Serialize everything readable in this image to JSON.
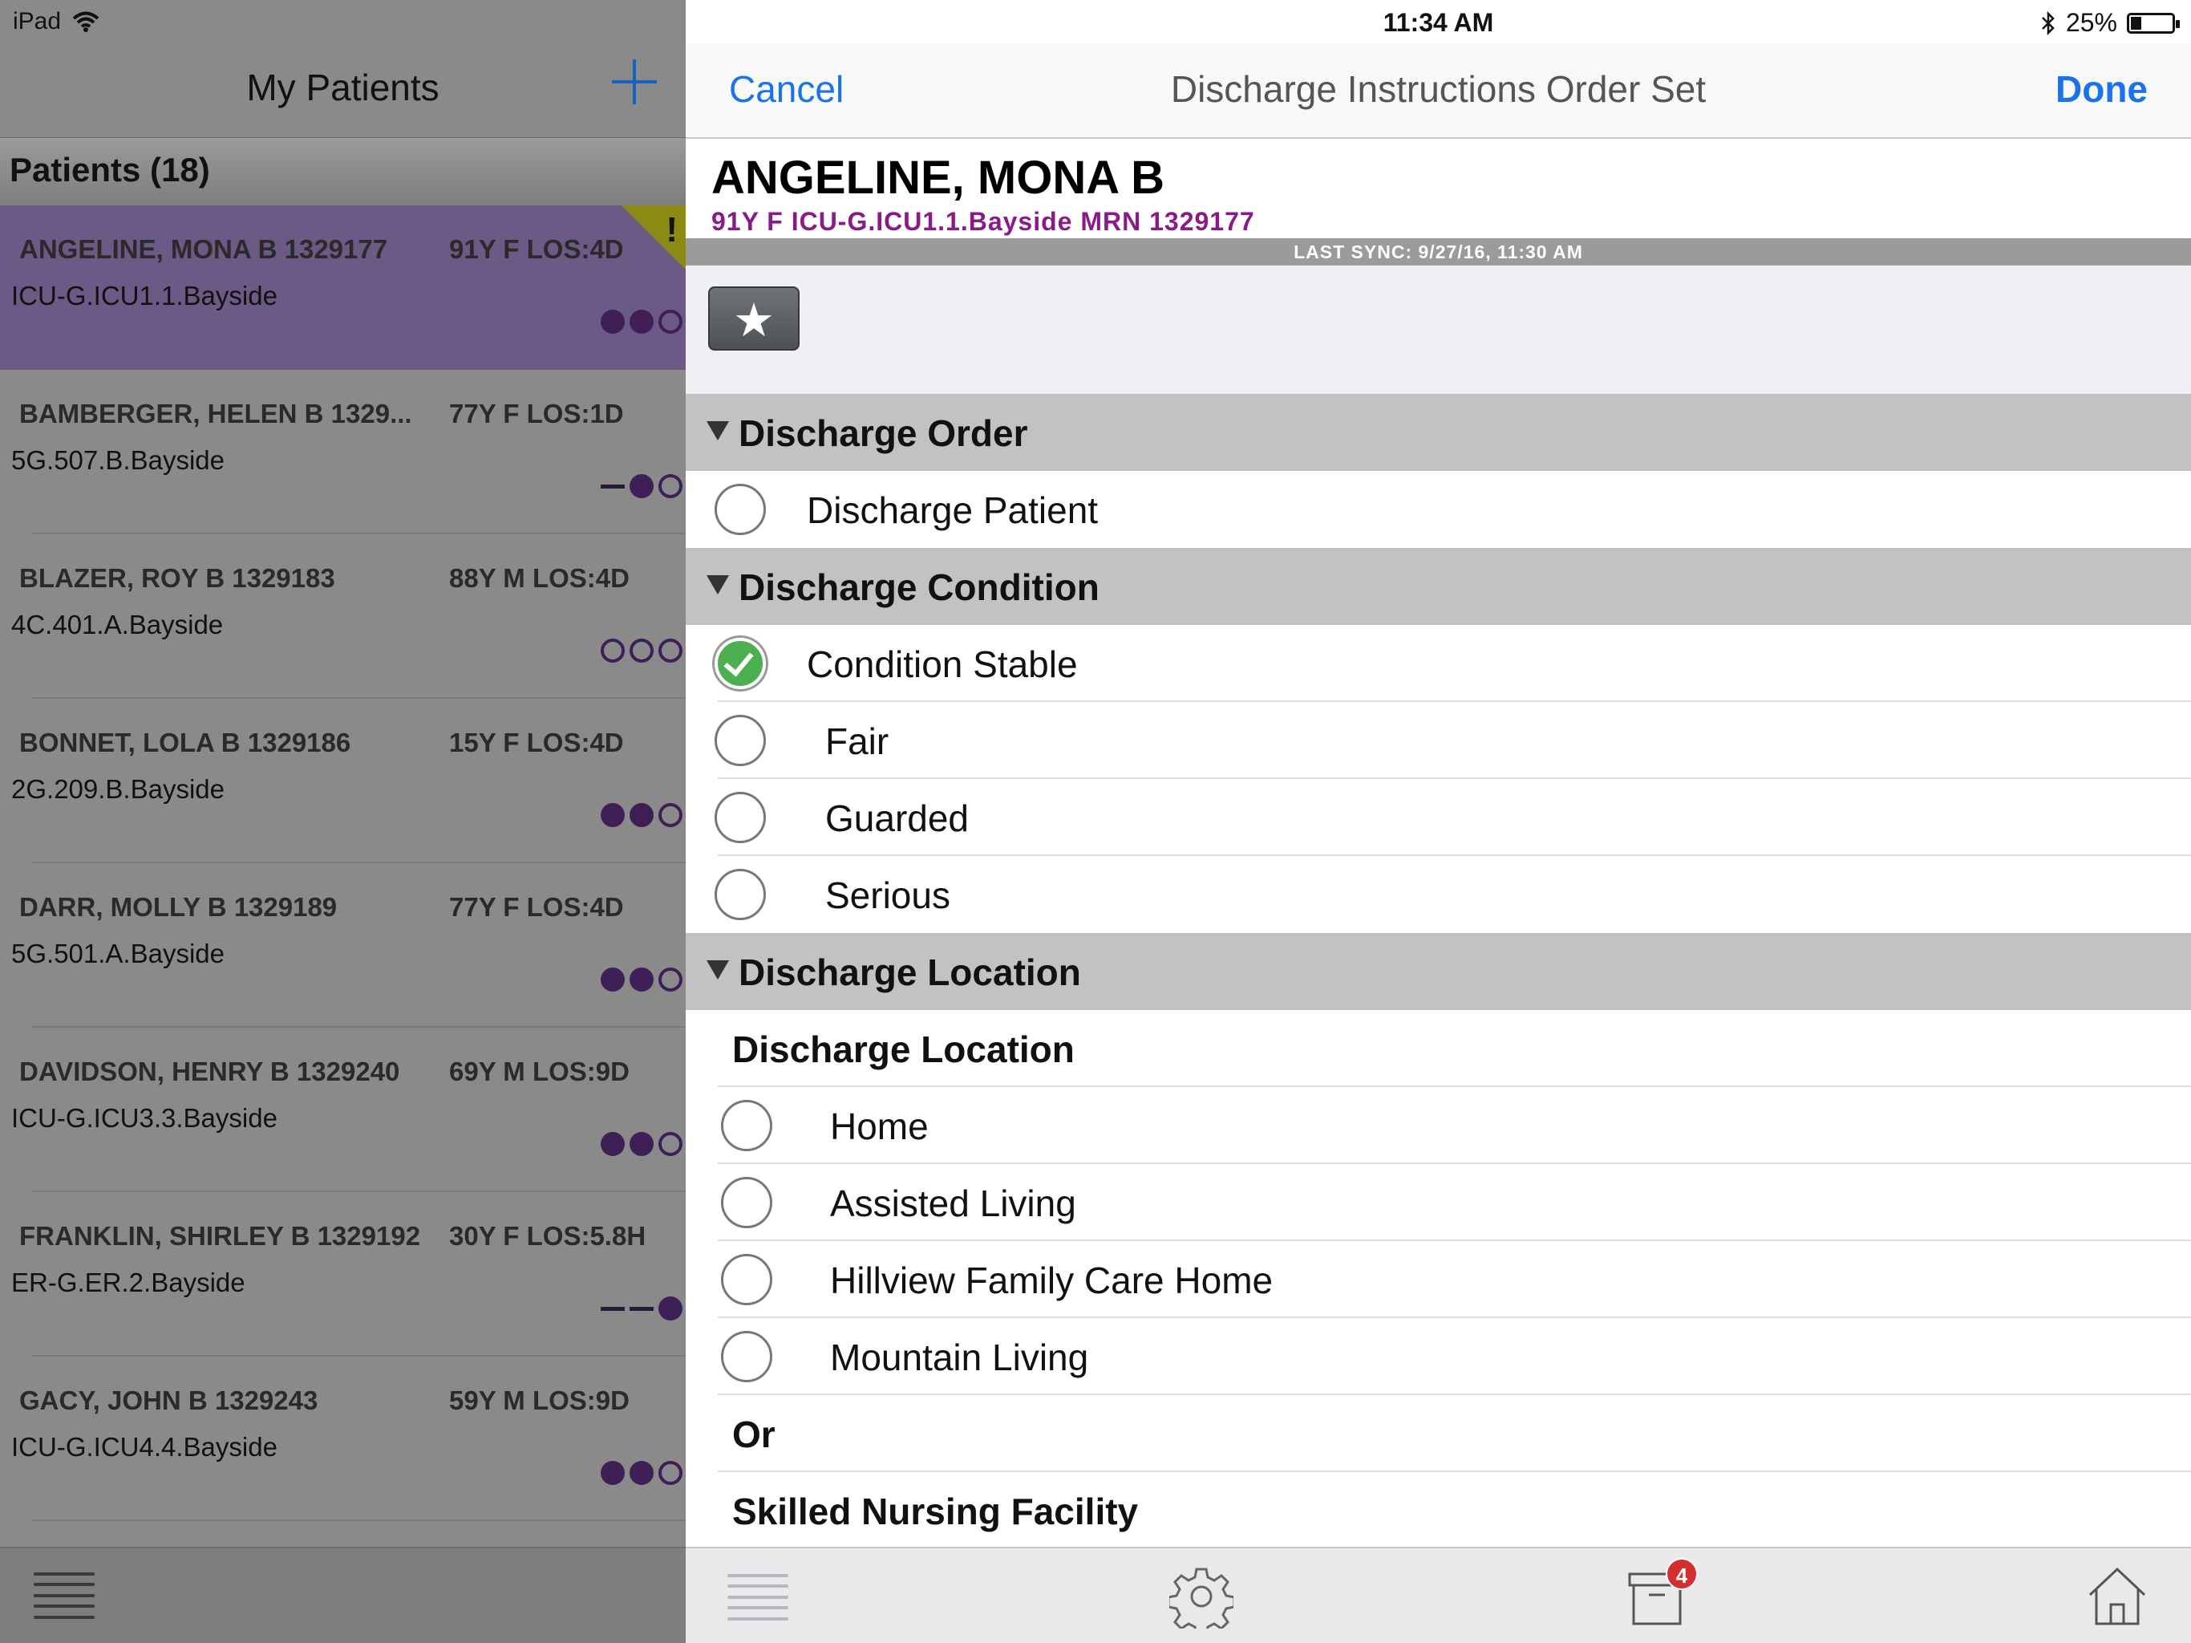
{
  "status_bar": {
    "device": "iPad",
    "time": "11:34 AM",
    "battery": "25%",
    "battery_level": 0.25
  },
  "left": {
    "title": "My Patients",
    "patients_header": "Patients (18)",
    "patients": [
      {
        "name": "ANGELINE, MONA B 1329177",
        "age": "91Y F LOS:4D",
        "location": "ICU-G.ICU1.1.Bayside",
        "indicators": [
          "filled",
          "filled",
          "empty"
        ],
        "alert": "!",
        "selected": true
      },
      {
        "name": "BAMBERGER, HELEN B 1329...",
        "age": "77Y F LOS:1D",
        "location": "5G.507.B.Bayside",
        "indicators": [
          "dash",
          "filled",
          "empty"
        ]
      },
      {
        "name": "BLAZER, ROY B 1329183",
        "age": "88Y M LOS:4D",
        "location": "4C.401.A.Bayside",
        "indicators": [
          "empty",
          "empty",
          "empty"
        ]
      },
      {
        "name": "BONNET, LOLA B 1329186",
        "age": "15Y F LOS:4D",
        "location": "2G.209.B.Bayside",
        "indicators": [
          "filled",
          "filled",
          "empty"
        ]
      },
      {
        "name": "DARR, MOLLY B 1329189",
        "age": "77Y F LOS:4D",
        "location": "5G.501.A.Bayside",
        "indicators": [
          "filled",
          "filled",
          "empty"
        ]
      },
      {
        "name": "DAVIDSON, HENRY B 1329240",
        "age": "69Y M LOS:9D",
        "location": "ICU-G.ICU3.3.Bayside",
        "indicators": [
          "filled",
          "filled",
          "empty"
        ]
      },
      {
        "name": "FRANKLIN, SHIRLEY B 1329192",
        "age": "30Y F LOS:5.8H",
        "location": "ER-G.ER.2.Bayside",
        "indicators": [
          "dash",
          "dash",
          "filled"
        ]
      },
      {
        "name": "GACY, JOHN B 1329243",
        "age": "59Y M LOS:9D",
        "location": "ICU-G.ICU4.4.Bayside",
        "indicators": [
          "filled",
          "filled",
          "empty"
        ]
      }
    ]
  },
  "right": {
    "cancel": "Cancel",
    "title": "Discharge Instructions Order Set",
    "done": "Done",
    "patient_name": "ANGELINE, MONA B",
    "patient_info": "91Y F ICU-G.ICU1.1.Bayside MRN 1329177",
    "last_sync": "LAST SYNC: 9/27/16, 11:30 AM",
    "sections": [
      {
        "type": "group",
        "label": "Discharge Order"
      },
      {
        "type": "option",
        "label": "Discharge Patient",
        "checked": false,
        "indent": 0
      },
      {
        "type": "group",
        "label": "Discharge Condition"
      },
      {
        "type": "option",
        "label": "Condition Stable",
        "checked": true,
        "indent": 0
      },
      {
        "type": "option",
        "label": "Fair",
        "checked": false,
        "indent": 1
      },
      {
        "type": "option",
        "label": "Guarded",
        "checked": false,
        "indent": 1
      },
      {
        "type": "option",
        "label": "Serious",
        "checked": false,
        "indent": 1
      },
      {
        "type": "group",
        "label": "Discharge Location"
      },
      {
        "type": "subheader",
        "label": "Discharge Location"
      },
      {
        "type": "option",
        "label": "Home",
        "checked": false,
        "indent": 2
      },
      {
        "type": "option",
        "label": "Assisted Living",
        "checked": false,
        "indent": 2
      },
      {
        "type": "option",
        "label": "Hillview Family Care Home",
        "checked": false,
        "indent": 2
      },
      {
        "type": "option",
        "label": "Mountain Living",
        "checked": false,
        "indent": 2
      },
      {
        "type": "subheader",
        "label": "Or"
      },
      {
        "type": "subheader",
        "label": "Skilled Nursing Facility"
      }
    ],
    "inbox_badge": "4"
  },
  "colors": {
    "accent_blue": "#1a73e8",
    "patient_info_purple": "#8b1a89",
    "selected_row": "#6b5a85",
    "check_green": "#4caf50"
  }
}
